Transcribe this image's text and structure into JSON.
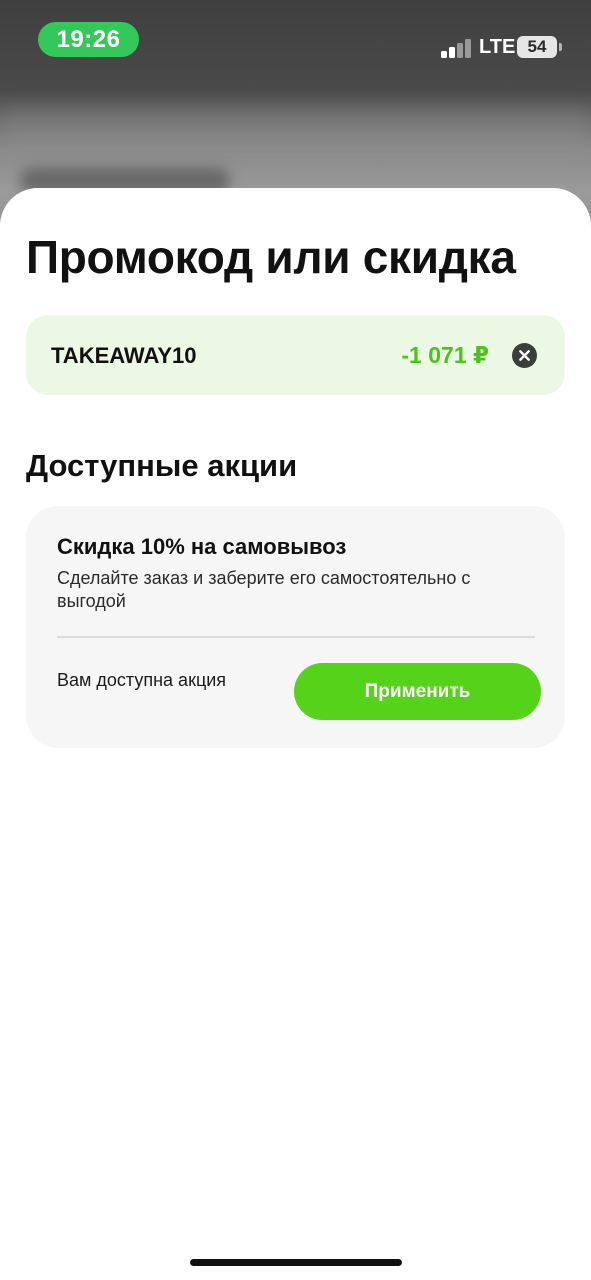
{
  "status_bar": {
    "time": "19:26",
    "network": "LTE",
    "battery": "54"
  },
  "sheet": {
    "title": "Промокод или скидка",
    "promo": {
      "code": "TAKEAWAY10",
      "discount": "-1 071 ₽"
    },
    "available_section": {
      "title": "Доступные акции",
      "offers": [
        {
          "title": "Скидка 10% на самовывоз",
          "description": "Сделайте заказ и заберите его самостоятельно с выгодой",
          "status": "Вам доступна акция",
          "action_label": "Применить"
        }
      ]
    }
  },
  "colors": {
    "accent_green": "#55d21a",
    "discount_green": "#4fc21a",
    "promo_card_bg": "#ebf8e3",
    "time_pill": "#34c759"
  },
  "icons": {
    "clear": "close-circle-icon",
    "signal": "cellular-signal-icon",
    "battery": "battery-icon"
  }
}
